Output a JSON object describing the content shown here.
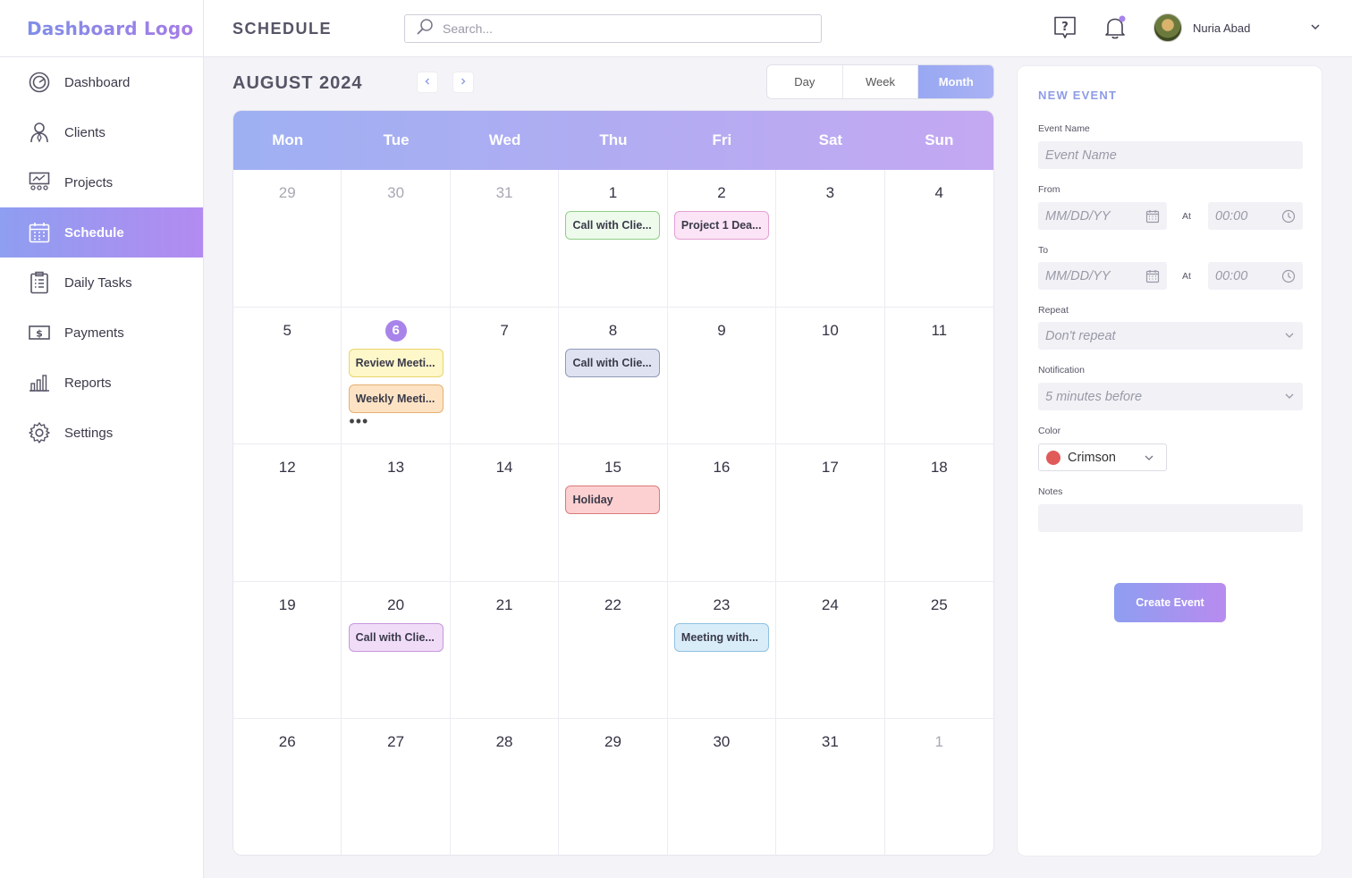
{
  "brand": {
    "logo": "Dashboard Logo"
  },
  "sidebar": {
    "items": [
      {
        "label": "Dashboard",
        "icon": "dashboard-icon"
      },
      {
        "label": "Clients",
        "icon": "clients-icon"
      },
      {
        "label": "Projects",
        "icon": "projects-icon"
      },
      {
        "label": "Schedule",
        "icon": "calendar-icon",
        "active": true
      },
      {
        "label": "Daily Tasks",
        "icon": "clipboard-icon"
      },
      {
        "label": "Payments",
        "icon": "dollar-icon"
      },
      {
        "label": "Reports",
        "icon": "bar-chart-icon"
      },
      {
        "label": "Settings",
        "icon": "gear-icon"
      }
    ]
  },
  "topbar": {
    "title": "SCHEDULE",
    "search_placeholder": "Search...",
    "user_name": "Nuria Abad"
  },
  "calendar": {
    "month_label": "AUGUST 2024",
    "views": [
      "Day",
      "Week",
      "Month"
    ],
    "active_view": "Month",
    "weekdays": [
      "Mon",
      "Tue",
      "Wed",
      "Thu",
      "Fri",
      "Sat",
      "Sun"
    ],
    "days": [
      {
        "n": "29",
        "muted": true
      },
      {
        "n": "30",
        "muted": true
      },
      {
        "n": "31",
        "muted": true
      },
      {
        "n": "1",
        "events": [
          {
            "label": "Call with Clie...",
            "color": "green"
          }
        ]
      },
      {
        "n": "2",
        "events": [
          {
            "label": "Project 1 Dea...",
            "color": "pink"
          }
        ]
      },
      {
        "n": "3"
      },
      {
        "n": "4"
      },
      {
        "n": "5"
      },
      {
        "n": "6",
        "today": true,
        "events": [
          {
            "label": "Review Meeti...",
            "color": "yellow"
          },
          {
            "label": "Weekly Meeti...",
            "color": "orange"
          }
        ],
        "more": "•••"
      },
      {
        "n": "7"
      },
      {
        "n": "8",
        "events": [
          {
            "label": "Call with Clie...",
            "color": "slate"
          }
        ]
      },
      {
        "n": "9"
      },
      {
        "n": "10"
      },
      {
        "n": "11"
      },
      {
        "n": "12"
      },
      {
        "n": "13"
      },
      {
        "n": "14"
      },
      {
        "n": "15",
        "events": [
          {
            "label": "Holiday",
            "color": "red"
          }
        ]
      },
      {
        "n": "16"
      },
      {
        "n": "17"
      },
      {
        "n": "18"
      },
      {
        "n": "19"
      },
      {
        "n": "20",
        "events": [
          {
            "label": "Call with Clie...",
            "color": "purple"
          }
        ]
      },
      {
        "n": "21"
      },
      {
        "n": "22"
      },
      {
        "n": "23",
        "events": [
          {
            "label": "Meeting with...",
            "color": "blue"
          }
        ]
      },
      {
        "n": "24"
      },
      {
        "n": "25"
      },
      {
        "n": "26"
      },
      {
        "n": "27"
      },
      {
        "n": "28"
      },
      {
        "n": "29"
      },
      {
        "n": "30"
      },
      {
        "n": "31"
      },
      {
        "n": "1",
        "muted": true
      }
    ],
    "event_colors": {
      "green": {
        "bg": "#eefaec",
        "border": "#8fcf86"
      },
      "pink": {
        "bg": "#fbe4f5",
        "border": "#e3a1d4"
      },
      "yellow": {
        "bg": "#fdf7c9",
        "border": "#e8d56b"
      },
      "orange": {
        "bg": "#fde3c4",
        "border": "#e6b072"
      },
      "slate": {
        "bg": "#dfe3f1",
        "border": "#8f99b8"
      },
      "red": {
        "bg": "#fcd0d0",
        "border": "#d97b7b"
      },
      "purple": {
        "bg": "#f0dcf7",
        "border": "#c696dc"
      },
      "blue": {
        "bg": "#d9edf9",
        "border": "#8ec1e2"
      }
    }
  },
  "new_event": {
    "title": "NEW EVENT",
    "event_name_label": "Event Name",
    "event_name_placeholder": "Event Name",
    "from_label": "From",
    "to_label": "To",
    "date_placeholder": "MM/DD/YY",
    "at_label": "At",
    "time_placeholder": "00:00",
    "repeat_label": "Repeat",
    "repeat_value": "Don't repeat",
    "notification_label": "Notification",
    "notification_value": "5 minutes before",
    "color_label": "Color",
    "color_value": "Crimson",
    "color_hex": "#e05a5a",
    "notes_label": "Notes",
    "create_button": "Create Event"
  },
  "theme": {
    "accent": "#a884ea",
    "accent_start": "#8e9ef0",
    "accent_end": "#b88bef"
  }
}
